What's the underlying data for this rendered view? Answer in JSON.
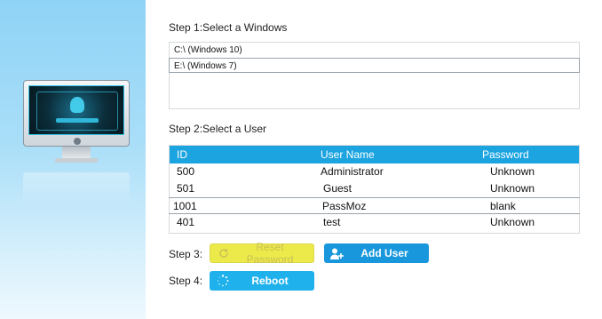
{
  "step1": {
    "label": "Step 1:Select a Windows",
    "windows": [
      "C:\\ (Windows 10)",
      "E:\\ (Windows  7)"
    ],
    "selected_index": 1
  },
  "step2": {
    "label": "Step 2:Select a User",
    "columns": {
      "id": "ID",
      "name": "User Name",
      "password": "Password"
    },
    "rows": [
      {
        "id": "500",
        "name": "Administrator",
        "password": "Unknown"
      },
      {
        "id": "501",
        "name": "Guest",
        "password": "Unknown"
      },
      {
        "id": "1001",
        "name": "PassMoz",
        "password": "blank"
      },
      {
        "id": "401",
        "name": "test",
        "password": "Unknown"
      }
    ],
    "selected_row": 2
  },
  "step3": {
    "label": "Step 3:",
    "reset_button": "Reset Password",
    "add_user_button": "Add User"
  },
  "step4": {
    "label": "Step 4:",
    "reboot_button": "Reboot"
  },
  "colors": {
    "accent": "#1ba4e0",
    "reset_bg": "#ecea4a",
    "add_bg": "#1897dc",
    "reboot_bg": "#1fb1ec"
  }
}
